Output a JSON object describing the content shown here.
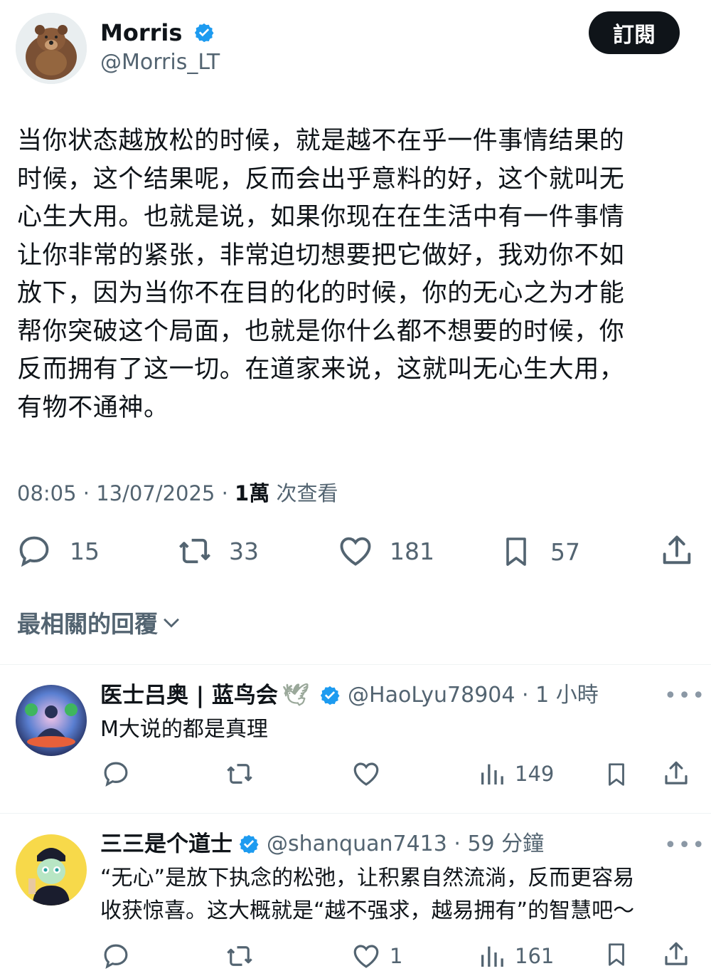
{
  "author": {
    "name": "Morris",
    "handle": "@Morris_LT",
    "avatar_icon": "bear-avatar-icon"
  },
  "subscribe_label": "訂閱",
  "post": {
    "lines": [
      "当你状态越放松的时候，就是越不在乎一件事情结果的",
      "时候，这个结果呢，反而会出乎意料的好，这个就叫无",
      "心生大用。也就是说，如果你现在在生活中有一件事情",
      "让你非常的紧张，非常迫切想要把它做好，我劝你不如",
      "放下，因为当你不在目的化的时候，你的无心之为才能",
      "帮你突破这个局面，也就是你什么都不想要的时候，你",
      "反而拥有了这一切。在道家来说，这就叫无心生大用，",
      "有物不通神。"
    ],
    "time": "08:05",
    "date": "13/07/2025",
    "views_count": "1萬",
    "views_label": "次查看"
  },
  "actions": {
    "replies": "15",
    "reposts": "33",
    "likes": "181",
    "bookmarks": "57"
  },
  "replies_filter_label": "最相關的回覆",
  "replies": [
    {
      "name": "医士吕奥 | 蓝鸟会",
      "handle": "@HaoLyu78904",
      "time": "1 小時",
      "text": [
        "M大说的都是真理"
      ],
      "likes": "",
      "views": "149"
    },
    {
      "name": "三三是个道士",
      "handle": "@shanquan7413",
      "time": "59 分鐘",
      "text": [
        "“无心”是放下执念的松弛，让积累自然流淌，反而更容易",
        "收获惊喜。这大概就是“越不强求，越易拥有”的智慧吧～"
      ],
      "likes": "1",
      "views": "161"
    }
  ],
  "colors": {
    "verified": "#1d9bf0",
    "muted": "#536471",
    "text": "#0f1419"
  }
}
